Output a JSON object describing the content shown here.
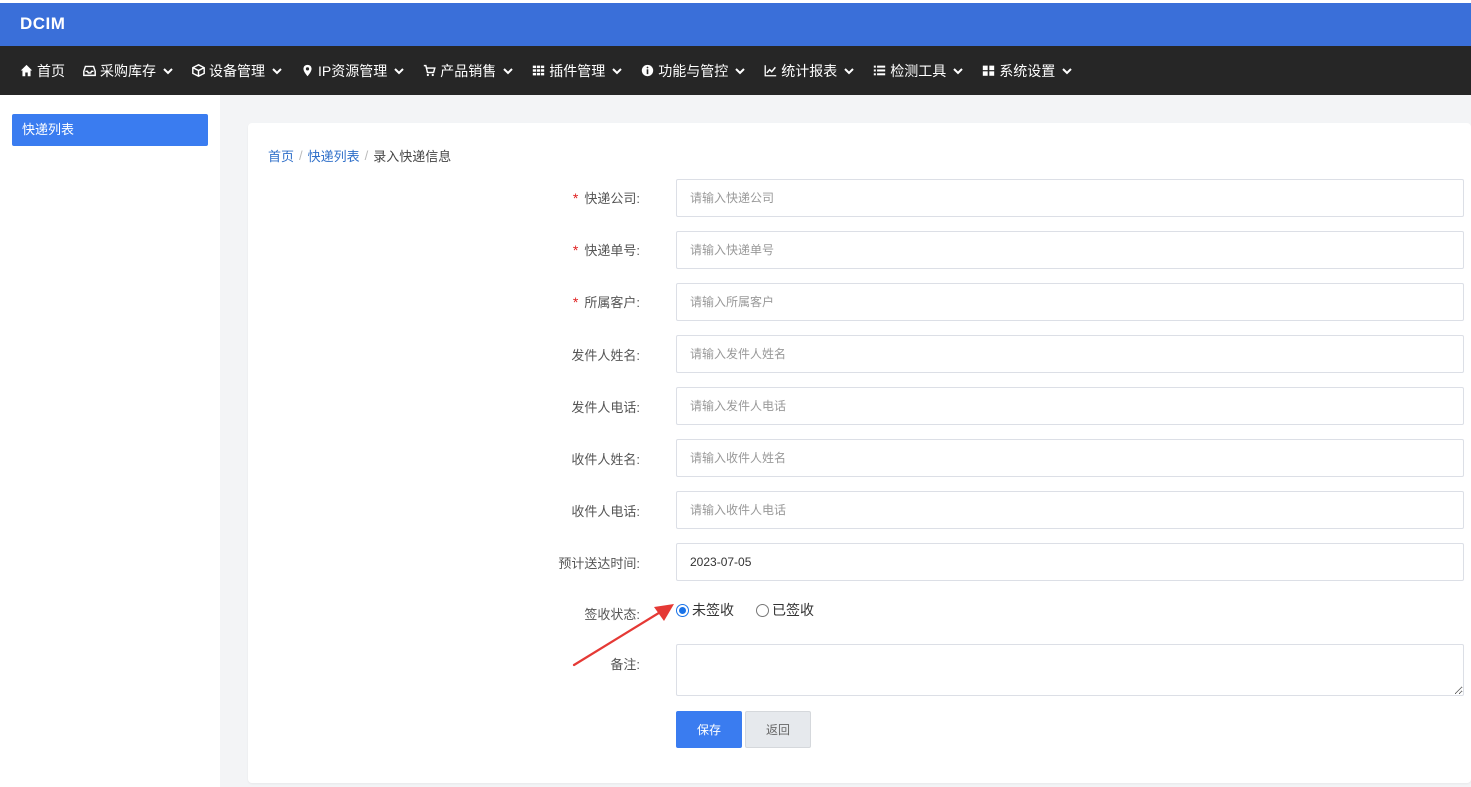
{
  "app": {
    "brand": "DCIM"
  },
  "nav": [
    {
      "label": "首页",
      "icon": "home-icon",
      "has_dropdown": false
    },
    {
      "label": "采购库存",
      "icon": "inbox-icon",
      "has_dropdown": true
    },
    {
      "label": "设备管理",
      "icon": "cube-icon",
      "has_dropdown": true
    },
    {
      "label": "IP资源管理",
      "icon": "map-marker-icon",
      "has_dropdown": true
    },
    {
      "label": "产品销售",
      "icon": "cart-icon",
      "has_dropdown": true
    },
    {
      "label": "插件管理",
      "icon": "grid-icon",
      "has_dropdown": true
    },
    {
      "label": "功能与管控",
      "icon": "info-icon",
      "has_dropdown": true
    },
    {
      "label": "统计报表",
      "icon": "line-chart-icon",
      "has_dropdown": true
    },
    {
      "label": "检测工具",
      "icon": "list-icon",
      "has_dropdown": true
    },
    {
      "label": "系统设置",
      "icon": "tiles-icon",
      "has_dropdown": true
    }
  ],
  "sidebar": {
    "items": [
      {
        "label": "快递列表",
        "active": true
      }
    ]
  },
  "breadcrumb": {
    "home": "首页",
    "list": "快递列表",
    "current": "录入快递信息"
  },
  "form": {
    "company": {
      "label": "快递公司:",
      "required": true,
      "placeholder": "请输入快递公司",
      "value": ""
    },
    "tracking": {
      "label": "快递单号:",
      "required": true,
      "placeholder": "请输入快递单号",
      "value": ""
    },
    "customer": {
      "label": "所属客户:",
      "required": true,
      "placeholder": "请输入所属客户",
      "value": ""
    },
    "sender_name": {
      "label": "发件人姓名:",
      "required": false,
      "placeholder": "请输入发件人姓名",
      "value": ""
    },
    "sender_phone": {
      "label": "发件人电话:",
      "required": false,
      "placeholder": "请输入发件人电话",
      "value": ""
    },
    "receiver_name": {
      "label": "收件人姓名:",
      "required": false,
      "placeholder": "请输入收件人姓名",
      "value": ""
    },
    "receiver_phone": {
      "label": "收件人电话:",
      "required": false,
      "placeholder": "请输入收件人电话",
      "value": ""
    },
    "eta": {
      "label": "预计送达时间:",
      "required": false,
      "value": "2023-07-05"
    },
    "status": {
      "label": "签收状态:",
      "options": [
        "未签收",
        "已签收"
      ],
      "selected": "未签收"
    },
    "remark": {
      "label": "备注:",
      "value": ""
    },
    "required_mark": "*",
    "save_label": "保存",
    "back_label": "返回"
  },
  "colors": {
    "brand_bar": "#3a6fd9",
    "nav_bg": "#262626",
    "primary": "#3a7cf0",
    "annotation_arrow": "#e53935"
  }
}
